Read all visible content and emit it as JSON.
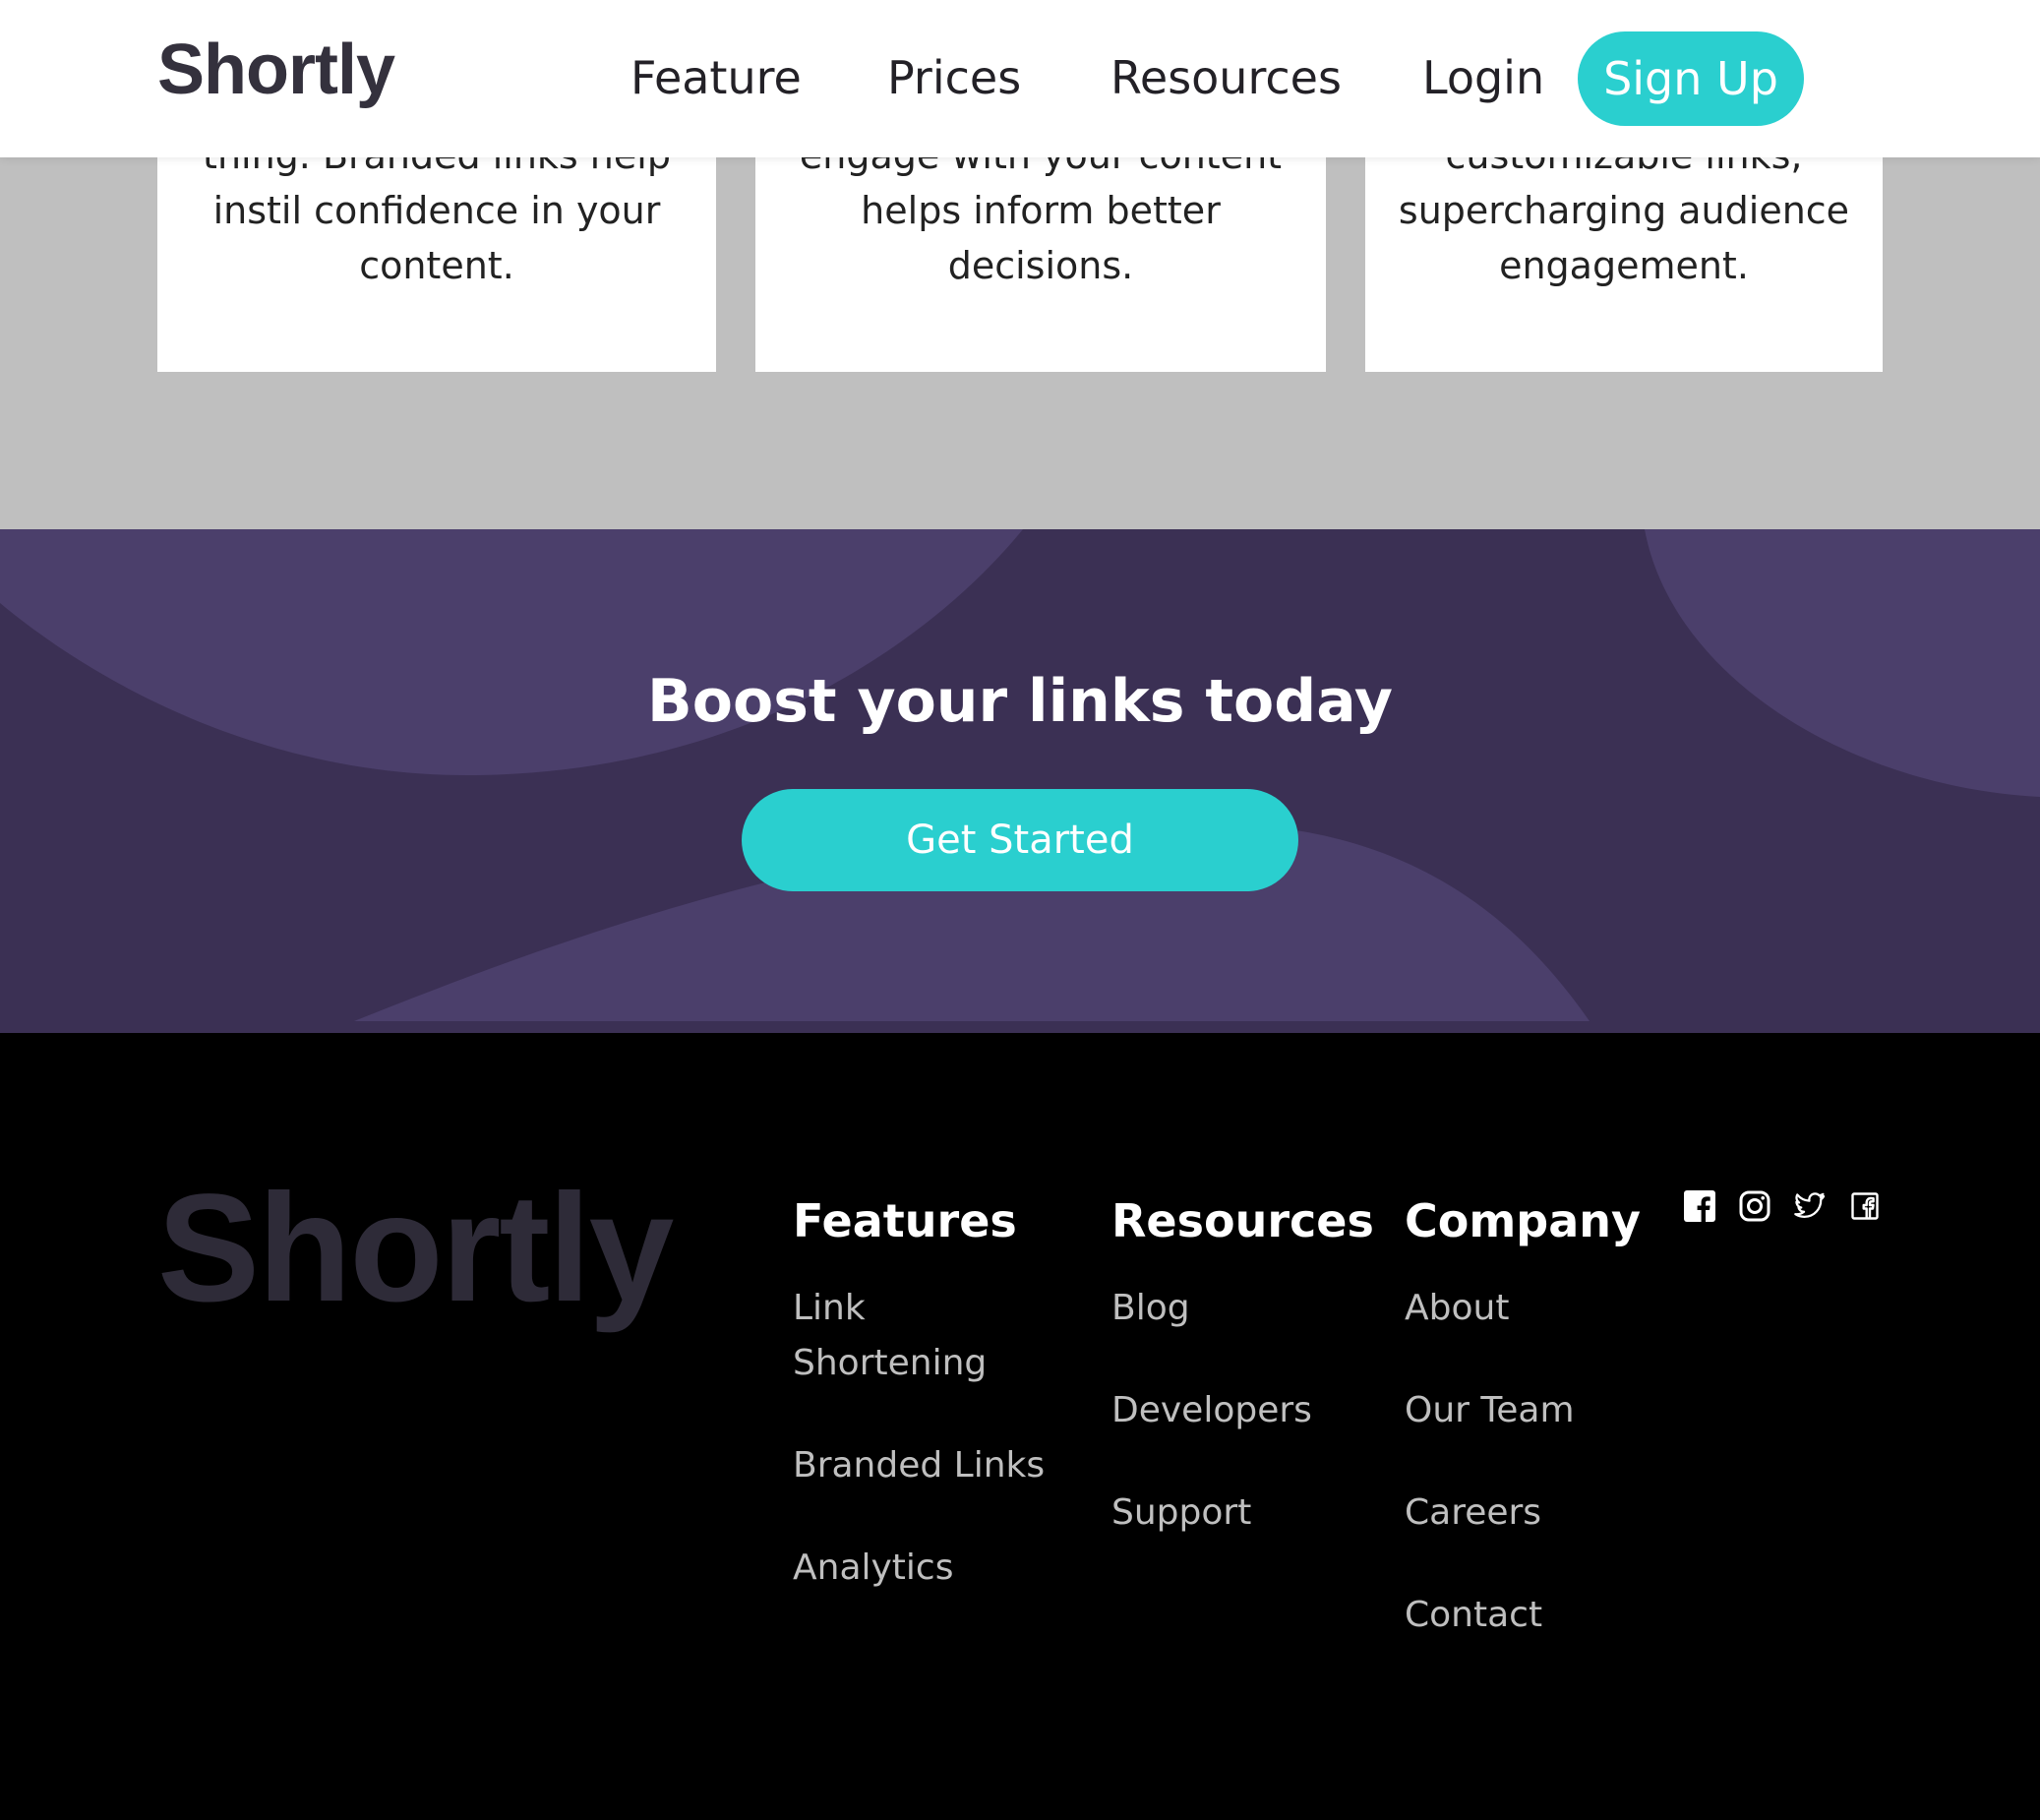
{
  "header": {
    "logo": "Shortly",
    "nav": {
      "feature": "Feature",
      "prices": "Prices",
      "resources": "Resources"
    },
    "login": "Login",
    "signup": "Sign Up"
  },
  "cards": [
    {
      "text": "thing. Branded links help instil confidence in your content."
    },
    {
      "text": "engage with your content helps inform better decisions."
    },
    {
      "text": "customizable links, supercharging audience engagement."
    }
  ],
  "boost": {
    "title": "Boost your links today",
    "button": "Get Started"
  },
  "footer": {
    "logo": "Shortly",
    "columns": [
      {
        "title": "Features",
        "links": [
          "Link Shortening",
          "Branded Links",
          "Analytics"
        ]
      },
      {
        "title": "Resources",
        "links": [
          "Blog",
          "Developers",
          "Support"
        ]
      },
      {
        "title": "Company",
        "links": [
          "About",
          "Our Team",
          "Careers",
          "Contact"
        ]
      }
    ],
    "socials": [
      "facebook-icon",
      "instagram-icon",
      "twitter-icon",
      "facebook-outline-icon"
    ]
  },
  "colors": {
    "accent": "#2acfcf",
    "dark_violet": "#3b3054",
    "light_violet": "#4b3f6b",
    "gray_bg": "#bfbfbf"
  }
}
